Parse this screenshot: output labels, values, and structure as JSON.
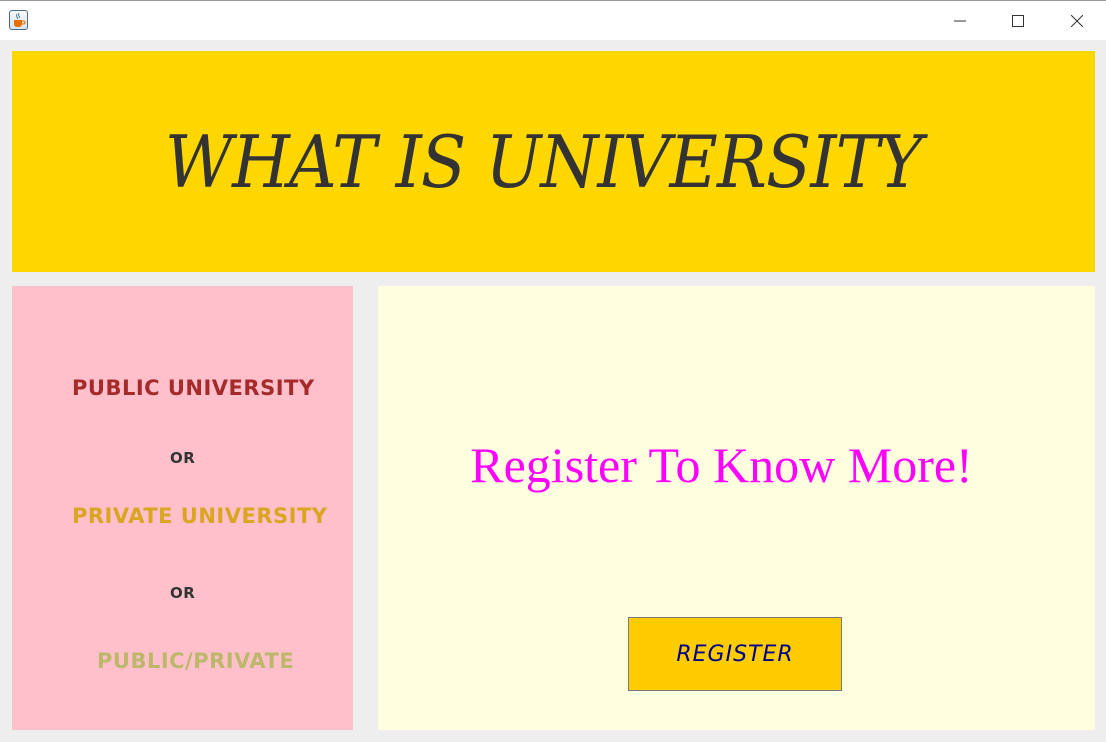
{
  "window": {
    "icon": "java-cup-icon",
    "controls": [
      "minimize-icon",
      "maximize-icon",
      "close-icon"
    ]
  },
  "header": {
    "title": "WHAT IS UNIVERSITY"
  },
  "options": {
    "public": "PUBLIC UNIVERSITY",
    "or_1": "OR",
    "private": "PRIVATE UNIVERSITY",
    "or_2": "OR",
    "both": "PUBLIC/PRIVATE"
  },
  "main": {
    "cta": "Register To Know More!",
    "register_label": "REGISTER"
  },
  "colors": {
    "header_bg": "#ffd700",
    "left_panel_bg": "#ffc0cb",
    "right_panel_bg": "#ffffe0",
    "public_text": "#a52a2a",
    "private_text": "#daa520",
    "both_text": "#bdb76b",
    "cta_text": "#ff00ff",
    "button_bg": "#ffcc00",
    "button_text": "#00008b"
  }
}
